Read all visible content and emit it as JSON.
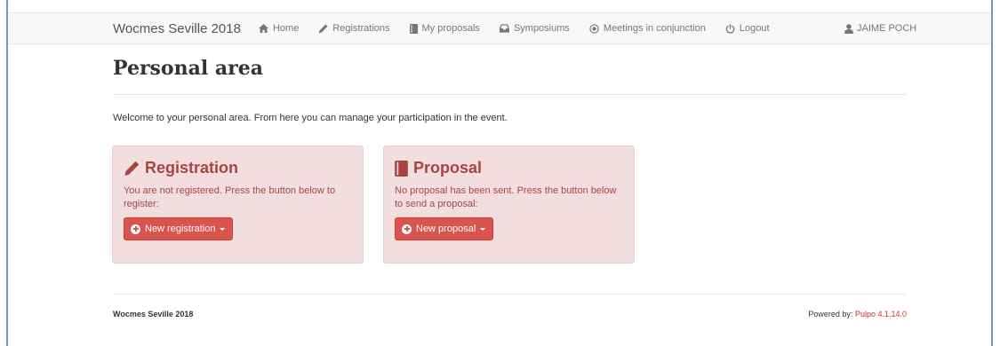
{
  "navbar": {
    "brand": "Wocmes Seville 2018",
    "items": [
      {
        "label": "Home",
        "icon": "home-icon"
      },
      {
        "label": "Registrations",
        "icon": "pencil-icon"
      },
      {
        "label": "My proposals",
        "icon": "book-icon"
      },
      {
        "label": "Symposiums",
        "icon": "inbox-icon"
      },
      {
        "label": "Meetings in conjunction",
        "icon": "record-icon"
      },
      {
        "label": "Logout",
        "icon": "power-icon"
      }
    ],
    "user": "JAIME POCH"
  },
  "page": {
    "title": "Personal area",
    "welcome": "Welcome to your personal area. From here you can manage your participation in the event."
  },
  "panels": {
    "registration": {
      "title": "Registration",
      "text": "You are not registered. Press the button below to register:",
      "button": "New registration"
    },
    "proposal": {
      "title": "Proposal",
      "text": "No proposal has been sent. Press the button below to send a proposal:",
      "button": "New proposal"
    }
  },
  "footer": {
    "left": "Wocmes Seville 2018",
    "powered_prefix": "Powered by:",
    "powered_link": "Pulpo 4.1.14.0"
  },
  "colors": {
    "panel_bg": "#f2dede",
    "panel_text": "#a94442",
    "button_bg": "#d9534f",
    "link": "#c9302c"
  }
}
